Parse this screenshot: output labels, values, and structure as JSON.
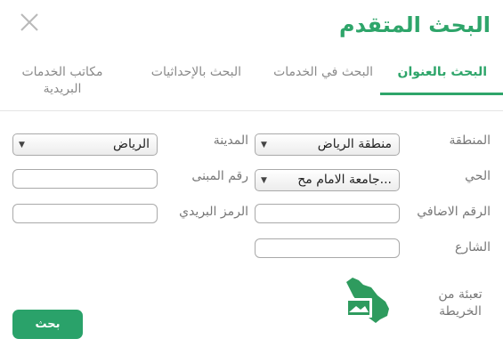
{
  "dialog": {
    "title": "البحث المتقدم",
    "close_icon": "close-icon"
  },
  "tabs": [
    {
      "label": "البحث بالعنوان",
      "active": true
    },
    {
      "label": "البحث في الخدمات",
      "active": false
    },
    {
      "label": "البحث بالإحداثيات",
      "active": false
    },
    {
      "label": "مكاتب الخدمات البريدية",
      "active": false
    }
  ],
  "form": {
    "region": {
      "label": "المنطقة",
      "value": "منطقة الرياض"
    },
    "city": {
      "label": "المدينة",
      "value": "الرياض"
    },
    "district": {
      "label": "الحي",
      "value": "...جامعة الامام مح"
    },
    "building_number": {
      "label": "رقم المبنى",
      "value": ""
    },
    "additional_number": {
      "label": "الرقم الاضافي",
      "value": ""
    },
    "postal_code": {
      "label": "الرمز البريدي",
      "value": ""
    },
    "street": {
      "label": "الشارع",
      "value": ""
    },
    "map_fill": {
      "label": "تعبئة من الخريطة",
      "icon": "saudi-map-icon"
    }
  },
  "search_button": {
    "label": "بحث"
  },
  "colors": {
    "accent": "#2ea56a",
    "button": "#2aa26a",
    "map_green": "#2e9b5e"
  }
}
